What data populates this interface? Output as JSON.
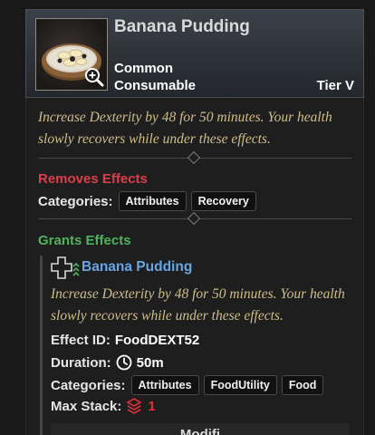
{
  "item": {
    "title": "Banana Pudding",
    "rarity": "Common",
    "type": "Consumable",
    "tier": "Tier V",
    "description": "Increase Dexterity by 48 for 50 minutes. Your health slowly recovers while under these effects."
  },
  "removes": {
    "title": "Removes Effects",
    "categories_label": "Categories:",
    "categories": [
      "Attributes",
      "Recovery"
    ]
  },
  "grants": {
    "title": "Grants Effects",
    "effect_name": "Banana Pudding",
    "description": "Increase Dexterity by 48 for 50 minutes. Your health slowly recovers while under these effects.",
    "effect_id_label": "Effect ID:",
    "effect_id": "FoodDEXT52",
    "duration_label": "Duration:",
    "duration": "50m",
    "categories_label": "Categories:",
    "categories": [
      "Attributes",
      "FoodUtility",
      "Food"
    ],
    "max_stack_label": "Max Stack:",
    "max_stack": "1"
  },
  "modifier_label": "Modifi",
  "colors": {
    "description": "#cfbd8c",
    "removes_title": "#d8404a",
    "grants_title": "#4fb35c",
    "effect_name": "#66a6e6",
    "stack": "#e0303a"
  },
  "icons": [
    "zoom-icon",
    "effect-plus-icon",
    "clock-icon",
    "stack-icon"
  ]
}
